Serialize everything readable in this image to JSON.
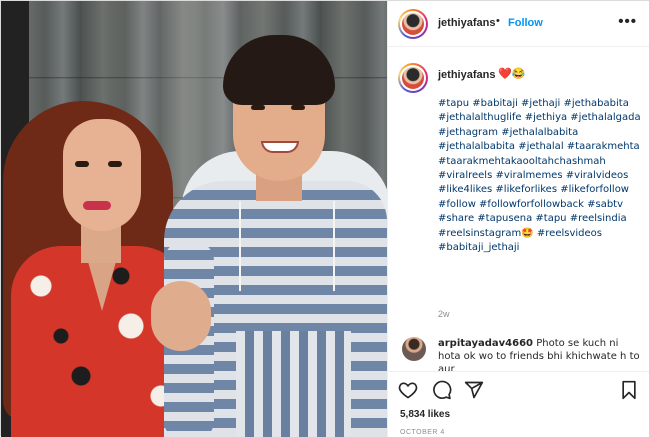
{
  "post": {
    "username": "jethiyafans",
    "follow_label": "Follow",
    "more_label": "•••",
    "dot": "•"
  },
  "caption": {
    "username": "jethiyafans",
    "emoji": "❤️😂",
    "hashtags": "#tapu #babitaji #jethaji #jethababita\n#jethalalthuglife #jethiya #jethalalgada\n#jethagram #jethalalbabita\n#jethalalbabita #jethalal #taarakmehta\n#taarakmehtakaooltahchashmah\n#viralreels #viralmemes #viralvideos\n#like4likes #likeforlikes #likeforfollow\n#follow #followforfollowback #sabtv\n#share #tapusena #tapu #reelsindia\n#reelsinstagram🤩 #reelsvideos\n#babitaji_jethaji",
    "time": "2w"
  },
  "comment": {
    "username": "arpitayadav4660",
    "text": "Photo se kuch ni hota ok wo to friends bhi khichwate h to aur"
  },
  "likes": "5,834 likes",
  "date": "OCTOBER 4",
  "icons": {
    "like": "heart-icon",
    "comment": "comment-icon",
    "share": "share-icon",
    "save": "bookmark-icon"
  },
  "colors": {
    "follow": "#0095f6",
    "hashtag": "#00376b",
    "muted": "#8e8e8e"
  }
}
